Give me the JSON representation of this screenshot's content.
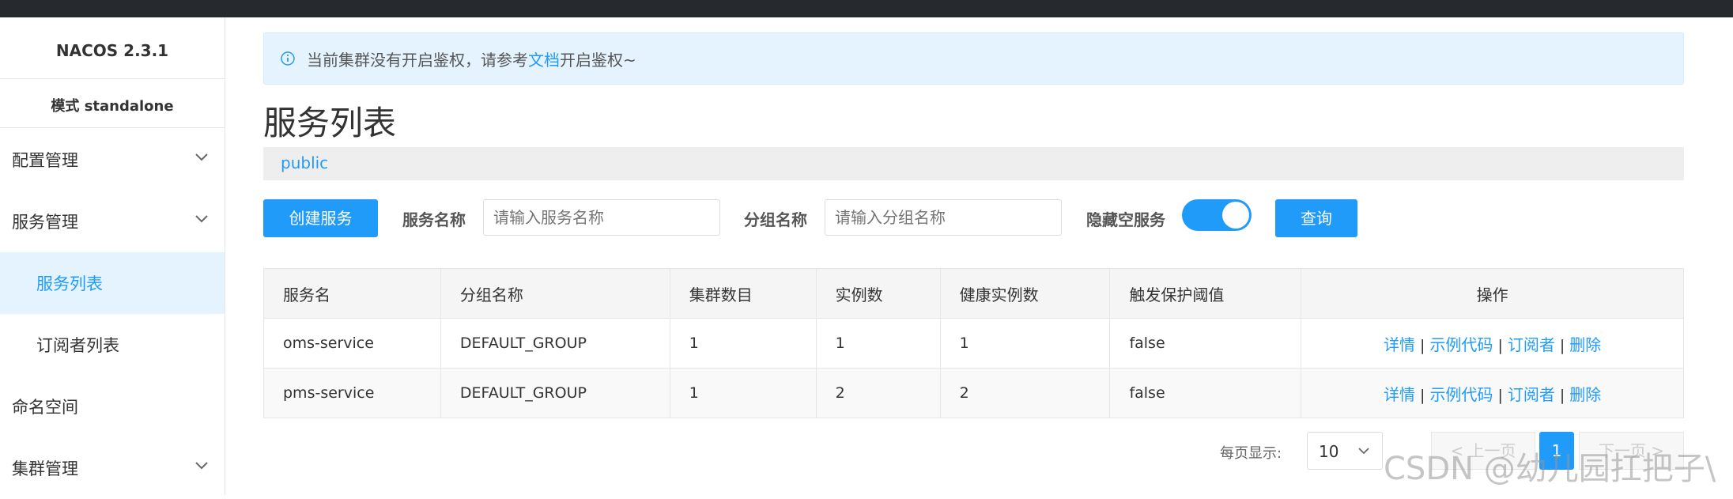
{
  "sidebar": {
    "app_title": "NACOS 2.3.1",
    "mode": "模式 standalone",
    "items": [
      {
        "label": "配置管理"
      },
      {
        "label": "服务管理"
      },
      {
        "label": "服务列表"
      },
      {
        "label": "订阅者列表"
      },
      {
        "label": "命名空间"
      },
      {
        "label": "集群管理"
      }
    ]
  },
  "notice": {
    "text_before": "当前集群没有开启鉴权，请参考",
    "link": "文档",
    "text_after": "开启鉴权~"
  },
  "page_title": "服务列表",
  "namespace": "public",
  "filters": {
    "create_button": "创建服务",
    "service_name_label": "服务名称",
    "service_name_placeholder": "请输入服务名称",
    "group_name_label": "分组名称",
    "group_name_placeholder": "请输入分组名称",
    "hide_empty_label": "隐藏空服务",
    "query_button": "查询"
  },
  "table": {
    "headers": [
      "服务名",
      "分组名称",
      "集群数目",
      "实例数",
      "健康实例数",
      "触发保护阈值",
      "操作"
    ],
    "rows": [
      {
        "name": "oms-service",
        "group": "DEFAULT_GROUP",
        "clusters": "1",
        "instances": "1",
        "healthy": "1",
        "threshold": "false"
      },
      {
        "name": "pms-service",
        "group": "DEFAULT_GROUP",
        "clusters": "1",
        "instances": "2",
        "healthy": "2",
        "threshold": "false"
      }
    ],
    "ops": {
      "detail": "详情",
      "sample_code": "示例代码",
      "subscribers": "订阅者",
      "delete": "删除",
      "separator": "|"
    }
  },
  "pagination": {
    "page_size_label": "每页显示:",
    "page_size": "10",
    "prev": "< 上一页",
    "current_page": "1",
    "next": "下一页 >"
  },
  "watermark": "CSDN @幼儿园扛把子\\",
  "colors": {
    "accent": "#209bfa",
    "topbar": "#262a2f",
    "notice_bg": "#e5f3ff"
  }
}
